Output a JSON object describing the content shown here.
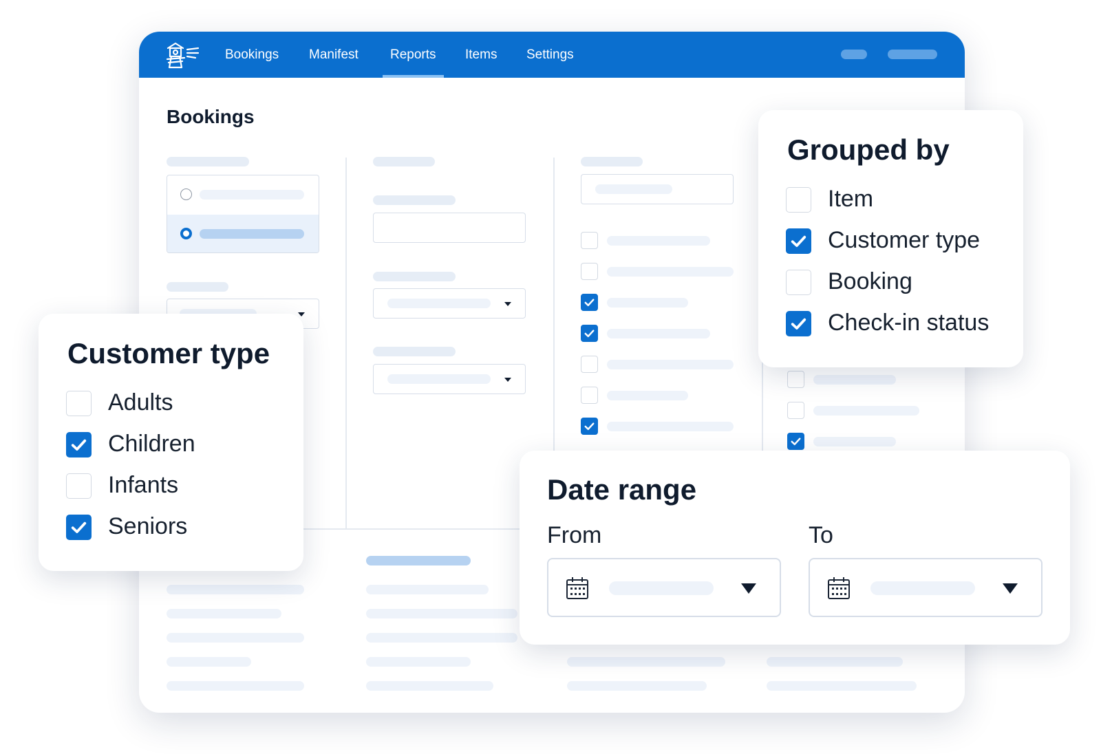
{
  "nav": {
    "items": [
      {
        "label": "Bookings",
        "active": false
      },
      {
        "label": "Manifest",
        "active": false
      },
      {
        "label": "Reports",
        "active": true
      },
      {
        "label": "Items",
        "active": false
      },
      {
        "label": "Settings",
        "active": false
      }
    ]
  },
  "page": {
    "title": "Bookings"
  },
  "background_checkboxes": {
    "column3": [
      false,
      false,
      true,
      true,
      false,
      false,
      true
    ],
    "column4": [
      false,
      false,
      true
    ]
  },
  "grouped_by": {
    "title": "Grouped by",
    "options": [
      {
        "label": "Item",
        "checked": false
      },
      {
        "label": "Customer type",
        "checked": true
      },
      {
        "label": "Booking",
        "checked": false
      },
      {
        "label": "Check-in status",
        "checked": true
      }
    ]
  },
  "customer_type": {
    "title": "Customer type",
    "options": [
      {
        "label": "Adults",
        "checked": false
      },
      {
        "label": "Children",
        "checked": true
      },
      {
        "label": "Infants",
        "checked": false
      },
      {
        "label": "Seniors",
        "checked": true
      }
    ]
  },
  "date_range": {
    "title": "Date range",
    "from_label": "From",
    "to_label": "To"
  },
  "colors": {
    "accent": "#0b6fcf",
    "skeleton": "#eef3fa",
    "skeleton_selected": "#b6d2f1"
  },
  "icons": [
    "lighthouse-logo-icon",
    "calendar-icon",
    "chevron-down-icon",
    "checkmark-icon"
  ]
}
